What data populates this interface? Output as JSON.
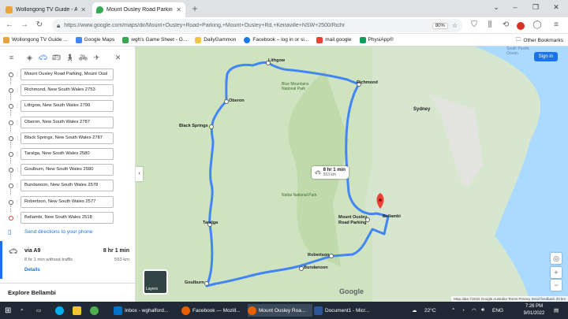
{
  "browser": {
    "tabs": [
      {
        "title": "Wollongong TV Guide - All TV S",
        "active": false
      },
      {
        "title": "Mount Ousley Road Parking to",
        "active": true
      }
    ],
    "url": "https://www.google.com/maps/dir/Mount+Ousley+Road+Parking,+Mount+Ousley+Rd,+Keiraville+NSW+2500/Richr",
    "zoom": "80%",
    "bookmarks": [
      "Wollongong TV Guide ...",
      "Google Maps",
      "wgh's Game Sheet - G...",
      "DailyGammon",
      "Facebook – log in or si...",
      "mail.google",
      "PhysiApp®"
    ],
    "other_bookmarks": "Other Bookmarks"
  },
  "directions": {
    "stops": [
      "Mount Ousley Road Parking, Mount Ousl",
      "Richmond, New South Wales 2753",
      "Lithgow, New South Wales 2790",
      "Oberon, New South Wales 2787",
      "Black Springs, New South Wales 2787",
      "Taralga, New South Wales 2580",
      "Goulburn, New South Wales 2580",
      "Bundanoon, New South Wales 2578",
      "Robertson, New South Wales 2577",
      "Bellambi, New South Wales 2518"
    ],
    "send_directions": "Send directions to your phone",
    "route": {
      "via": "via A9",
      "duration": "8 hr 1 min",
      "traffic_note": "8 hr 1 min without traffic",
      "distance": "553 km",
      "details": "Details"
    },
    "explore": "Explore Bellambi"
  },
  "map": {
    "sign_in": "Sign in",
    "route_time": "8 hr 1 min",
    "route_dist": "553 km",
    "labels": {
      "lithgow": "Lithgow",
      "richmond": "Richmond",
      "oberon": "Oberon",
      "black_springs": "Black Springs",
      "sydney": "Sydney",
      "mount_ousley": "Mount Ousley Road Parking",
      "bellambi": "Bellambi",
      "taralga": "Taralga",
      "goulburn": "Goulburn",
      "bundanoon": "Bundanoon",
      "robertson": "Robertson",
      "nattai": "Nattai National Park",
      "blue_mountains": "Blue Mountains National Park",
      "south_pacific": "South Pacific Ocean"
    },
    "layers": "Layers",
    "google": "Google",
    "attribution": "Map data ©2022 Google   Australia   Terms   Privacy   Send feedback   20 km"
  },
  "taskbar": {
    "items": [
      "Inbox - wghalford...",
      "Facebook — Mozill...",
      "Mount Ousley Roa...",
      "Document1 - Micr..."
    ],
    "temperature": "22°C",
    "language": "ENG",
    "time": "7:26 PM",
    "date": "9/01/2022"
  },
  "colors": {
    "route": "#4285f4",
    "accent": "#1a73e8",
    "pin": "#ea4335"
  }
}
